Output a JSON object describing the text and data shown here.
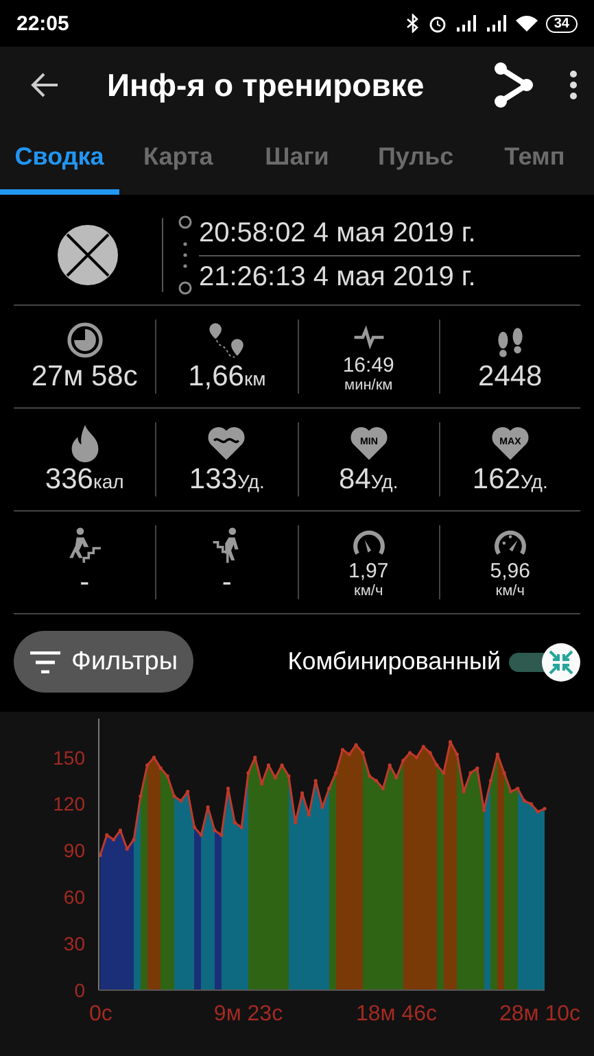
{
  "status_bar": {
    "time": "22:05",
    "battery": "34"
  },
  "app_bar": {
    "title": "Инф-я о тренировке"
  },
  "tabs": [
    {
      "label": "Сводка",
      "selected": true
    },
    {
      "label": "Карта",
      "selected": false
    },
    {
      "label": "Шаги",
      "selected": false
    },
    {
      "label": "Пульс",
      "selected": false
    },
    {
      "label": "Темп",
      "selected": false
    }
  ],
  "session": {
    "start": "20:58:02  4 мая 2019 г.",
    "end": "21:26:13  4 мая 2019 г."
  },
  "stats": [
    [
      {
        "kind": "inline",
        "value": "27м 58с"
      },
      {
        "kind": "inline",
        "value": "1,66",
        "unit": "км"
      },
      {
        "kind": "stacked",
        "value": "16:49",
        "unit": "мин/км"
      },
      {
        "kind": "inline",
        "value": "2448"
      }
    ],
    [
      {
        "kind": "inline",
        "value": "336",
        "unit": "кал"
      },
      {
        "kind": "inline",
        "value": "133",
        "unit": "Уд."
      },
      {
        "icon_text": "MIN",
        "kind": "inline",
        "value": "84",
        "unit": "Уд."
      },
      {
        "icon_text": "MAX",
        "kind": "inline",
        "value": "162",
        "unit": "Уд."
      }
    ],
    [
      {
        "kind": "inline",
        "value": "-"
      },
      {
        "kind": "inline",
        "value": "-"
      },
      {
        "kind": "stacked",
        "value": "1,97",
        "unit": "км/ч"
      },
      {
        "kind": "stacked",
        "value": "5,96",
        "unit": "км/ч"
      }
    ]
  ],
  "filters_button": {
    "label": "Фильтры"
  },
  "combined_toggle": {
    "label": "Комбинированный",
    "on": true
  },
  "chart_data": {
    "type": "area",
    "categories": [
      "0с",
      null,
      null,
      null,
      null,
      null,
      null,
      null,
      null,
      null,
      null,
      null,
      null,
      null,
      null,
      null,
      null,
      null,
      null,
      null,
      null,
      null,
      "9м 23с",
      null,
      null,
      null,
      null,
      null,
      null,
      null,
      null,
      null,
      null,
      null,
      null,
      null,
      null,
      null,
      null,
      null,
      null,
      null,
      null,
      null,
      "18м 46с",
      null,
      null,
      null,
      null,
      null,
      null,
      null,
      null,
      null,
      null,
      null,
      null,
      null,
      null,
      null,
      null,
      null,
      null,
      null,
      null,
      null,
      "28м 10с"
    ],
    "series": [
      {
        "color": "#c0392b",
        "values": [
          87,
          100,
          97,
          103,
          91,
          97,
          125,
          145,
          150,
          143,
          138,
          125,
          122,
          128,
          105,
          100,
          118,
          103,
          100,
          130,
          108,
          105,
          140,
          150,
          133,
          145,
          137,
          145,
          138,
          108,
          127,
          113,
          135,
          118,
          130,
          140,
          155,
          152,
          158,
          153,
          138,
          135,
          130,
          145,
          137,
          148,
          153,
          150,
          157,
          153,
          145,
          140,
          160,
          152,
          128,
          140,
          143,
          116,
          135,
          152,
          140,
          128,
          130,
          122,
          120,
          115,
          117
        ]
      }
    ],
    "ylim": [
      0,
      175
    ],
    "yticks": [
      0,
      30,
      60,
      90,
      120,
      150
    ]
  }
}
